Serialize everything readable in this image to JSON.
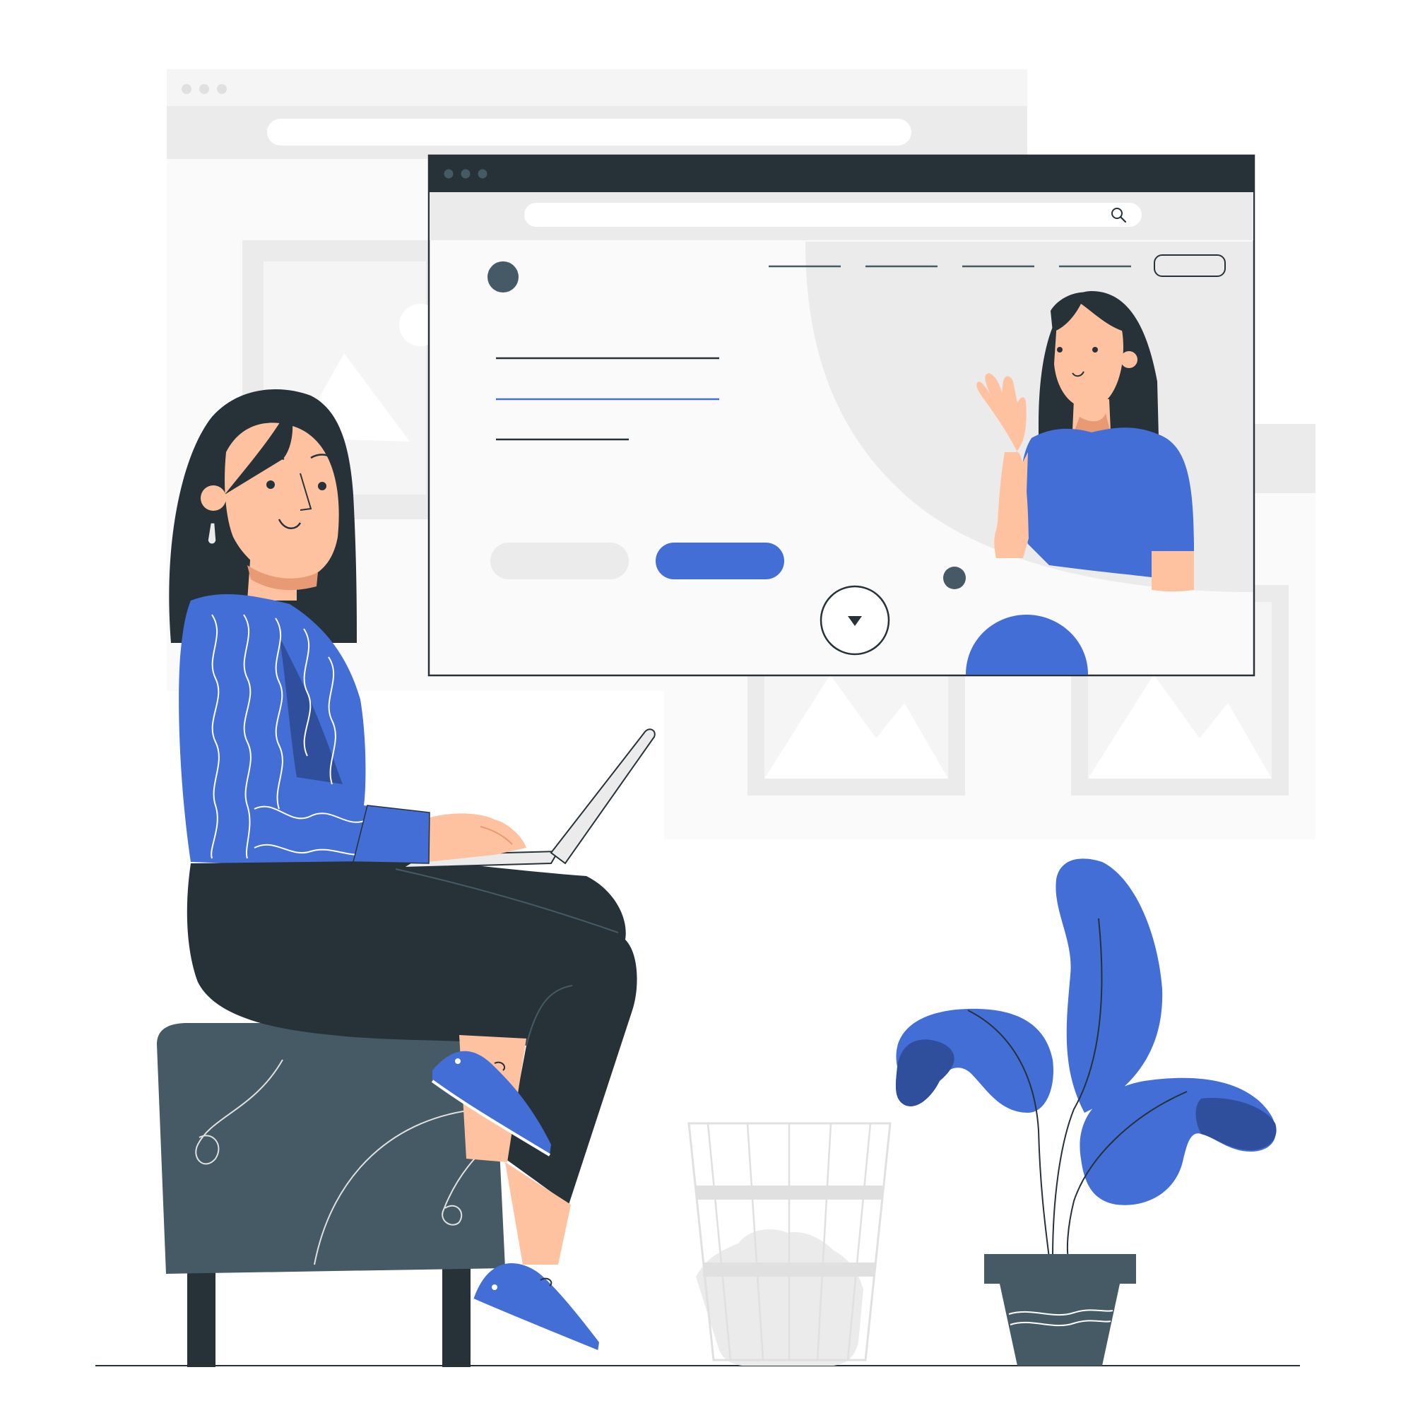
{
  "colors": {
    "background": "#ffffff",
    "accent_blue": "#426ed6",
    "accent_blue_dark": "#2f4f9c",
    "dark_navy": "#263238",
    "slate": "#455a64",
    "skin": "#ffc2a1",
    "skin_shadow": "#e89a74",
    "light_gray": "#ebebeb",
    "lighter_gray": "#f5f5f5",
    "panel_gray": "#fafafa"
  },
  "icons": {
    "search": "search-icon",
    "scroll_down": "chevron-down-icon",
    "image_placeholder": "image-placeholder-icon"
  },
  "scene": {
    "subjects": [
      "woman-with-laptop",
      "woman-waving-in-browser",
      "office-stool",
      "waste-basket",
      "potted-plant"
    ]
  }
}
